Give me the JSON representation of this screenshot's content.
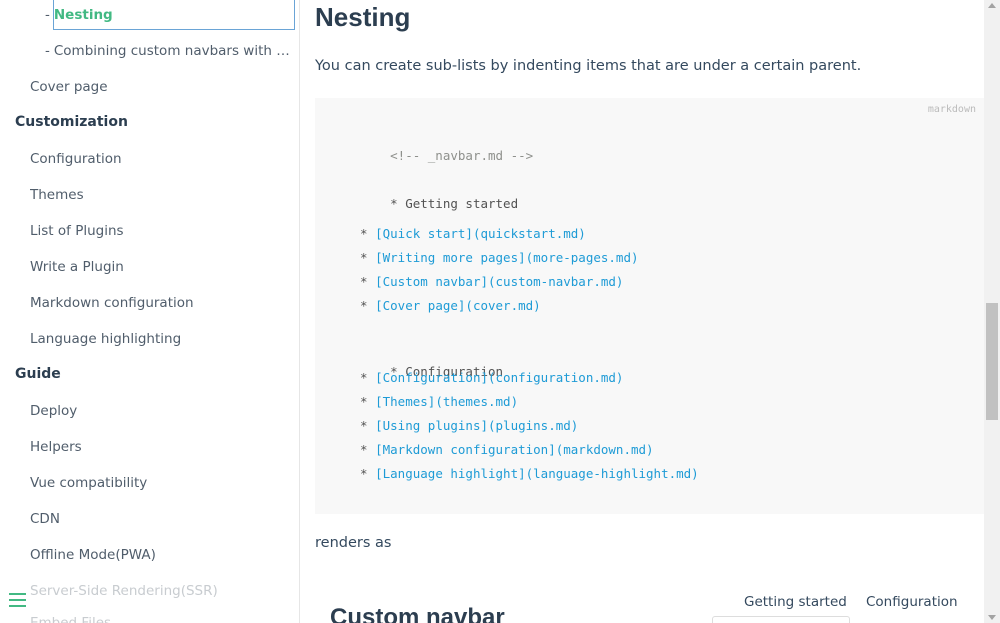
{
  "sidebar": {
    "sub_items": [
      {
        "dash": "-",
        "label": "Nesting",
        "active": true
      },
      {
        "dash": "-",
        "label": "Combining custom navbars with the emoji plugin",
        "active": false
      }
    ],
    "cover_page": "Cover page",
    "sections": [
      {
        "heading": "Customization",
        "items": [
          "Configuration",
          "Themes",
          "List of Plugins",
          "Write a Plugin",
          "Markdown configuration",
          "Language highlighting"
        ]
      },
      {
        "heading": "Guide",
        "items": [
          "Deploy",
          "Helpers",
          "Vue compatibility",
          "CDN",
          "Offline Mode(PWA)",
          "Server-Side Rendering(SSR)",
          "Embed Files"
        ]
      }
    ],
    "toggle_icon": "menu-icon"
  },
  "main": {
    "title": "Nesting",
    "intro": "You can create sub-lists by indenting items that are under a certain parent.",
    "code": {
      "lang": "markdown",
      "lines": [
        {
          "text": "<!-- _navbar.md -->",
          "type": "comment"
        },
        {
          "text": "* Getting started",
          "type": "bullet"
        },
        {
          "bullet": "  * ",
          "text": "[Quick start](quickstart.md)",
          "type": "link"
        },
        {
          "bullet": "  * ",
          "text": "[Writing more pages](more-pages.md)",
          "type": "link"
        },
        {
          "bullet": "  * ",
          "text": "[Custom navbar](custom-navbar.md)",
          "type": "link"
        },
        {
          "bullet": "  * ",
          "text": "[Cover page](cover.md)",
          "type": "link"
        },
        {
          "text": "* Configuration",
          "type": "bullet"
        },
        {
          "bullet": "  * ",
          "text": "[Configuration](configuration.md)",
          "type": "link"
        },
        {
          "bullet": "  * ",
          "text": "[Themes](themes.md)",
          "type": "link"
        },
        {
          "bullet": "  * ",
          "text": "[Using plugins](plugins.md)",
          "type": "link"
        },
        {
          "bullet": "  * ",
          "text": "[Markdown configuration](markdown.md)",
          "type": "link"
        },
        {
          "bullet": "  * ",
          "text": "[Language highlight](language-highlight.md)",
          "type": "link"
        }
      ]
    },
    "renders_as": "renders as",
    "preview": {
      "title": "Custom navbar",
      "nav": [
        "Getting started",
        "Configuration"
      ]
    }
  },
  "colors": {
    "accent": "#42b983",
    "link": "#1e9bd6",
    "text": "#34495e",
    "code_bg": "#f8f8f8"
  }
}
